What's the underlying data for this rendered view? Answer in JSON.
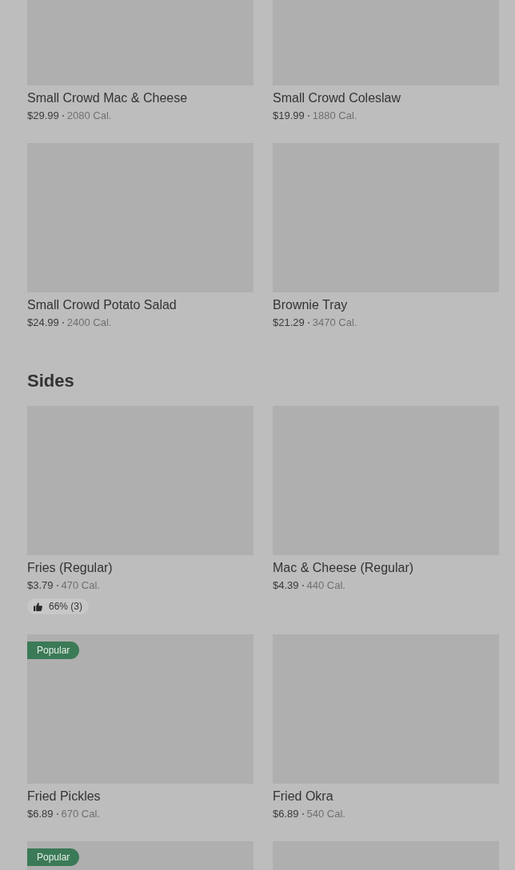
{
  "sections": [
    {
      "items": [
        {
          "name": "Small Crowd Mac & Cheese",
          "price": "$29.99",
          "calories": "2080 Cal."
        },
        {
          "name": "Small Crowd Coleslaw",
          "price": "$19.99",
          "calories": "1880 Cal."
        },
        {
          "name": "Small Crowd Potato Salad",
          "price": "$24.99",
          "calories": "2400 Cal."
        },
        {
          "name": "Brownie Tray",
          "price": "$21.29",
          "calories": "3470 Cal."
        }
      ]
    },
    {
      "title": "Sides",
      "items": [
        {
          "name": "Fries (Regular)",
          "price": "$3.79",
          "calories": "470 Cal.",
          "rating": "66% (3)"
        },
        {
          "name": "Mac & Cheese (Regular)",
          "price": "$4.39",
          "calories": "440 Cal."
        },
        {
          "badge": "Popular",
          "name": "Fried Pickles",
          "price": "$6.89",
          "calories": "670 Cal."
        },
        {
          "name": "Fried Okra",
          "price": "$6.89",
          "calories": "540 Cal."
        },
        {
          "kind": "picture",
          "badge": "Popular"
        },
        {
          "kind": "picture"
        }
      ]
    }
  ]
}
